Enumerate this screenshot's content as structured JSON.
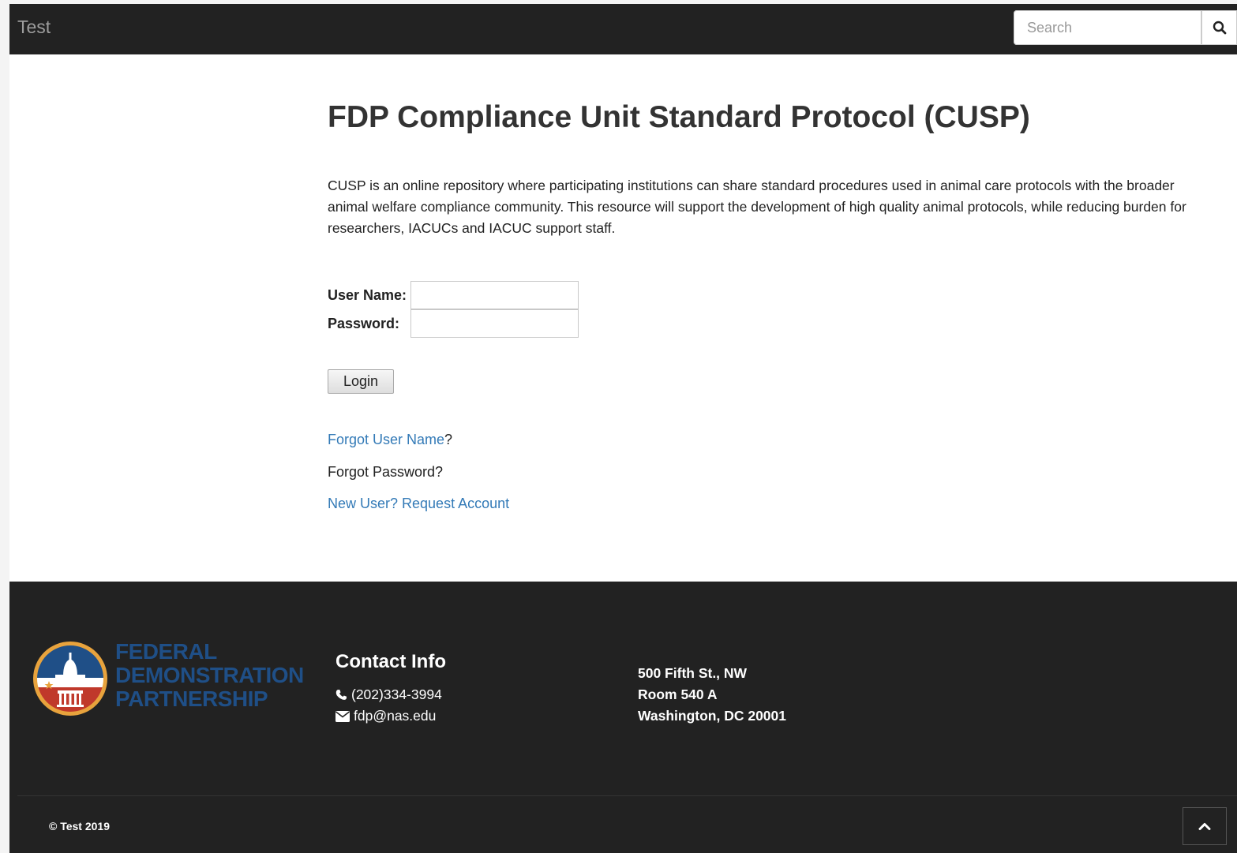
{
  "navbar": {
    "brand": "Test",
    "search": {
      "placeholder": "Search",
      "value": ""
    }
  },
  "main": {
    "title": "FDP Compliance Unit Standard Protocol (CUSP)",
    "intro": "CUSP is an online repository where participating institutions can share standard procedures used in animal care protocols with the broader animal welfare compliance community. This resource will support the development of high quality animal protocols, while reducing burden for researchers, IACUCs and IACUC support staff.",
    "login": {
      "username_label": "User Name:",
      "username_value": "",
      "password_label": "Password:",
      "password_value": "",
      "button_label": "Login"
    },
    "links": {
      "forgot_username": "Forgot User Name",
      "forgot_username_suffix": "?",
      "forgot_password": "Forgot Password?",
      "new_user": "New User? Request Account"
    }
  },
  "footer": {
    "logo": {
      "line1": "FEDERAL",
      "line2": "DEMONSTRATION",
      "line3": "PARTNERSHIP",
      "icon": "capitol-seal-icon"
    },
    "contact": {
      "heading": "Contact Info",
      "phone": "(202)334-3994",
      "email": "fdp@nas.edu"
    },
    "address": {
      "line1": "500 Fifth St., NW",
      "line2": "Room 540 A",
      "line3": "Washington, DC 20001"
    },
    "copyright": "© Test 2019"
  },
  "colors": {
    "navbar_bg": "#222222",
    "link": "#337ab7",
    "logo_blue": "#1f4f87",
    "logo_red": "#c0392b",
    "logo_gold": "#e8a33d"
  }
}
